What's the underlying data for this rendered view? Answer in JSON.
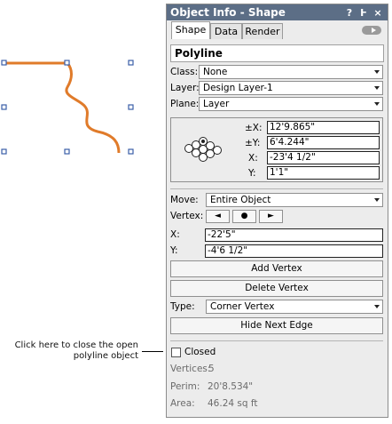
{
  "palette": {
    "title": "Object Info - Shape",
    "help_glyph": "?",
    "pin_glyph": "Ͱ",
    "close_glyph": "×",
    "tabs": [
      {
        "label": "Shape",
        "active": true
      },
      {
        "label": "Data",
        "active": false
      },
      {
        "label": "Render",
        "active": false
      }
    ],
    "object_type": "Polyline",
    "class_label": "Class:",
    "class_value": "None",
    "layer_label": "Layer:",
    "layer_value": "Design Layer-1",
    "plane_label": "Plane:",
    "plane_value": "Layer",
    "coords": {
      "x_label": "±X:",
      "x_value": "12'9.865\"",
      "y_label": "±Y:",
      "y_value": "6'4.244\"",
      "xs_label": "X:",
      "xs_value": "-23'4 1/2\"",
      "ys_label": "Y:",
      "ys_value": "1'1\""
    },
    "move_label": "Move:",
    "move_value": "Entire Object",
    "vertex_label": "Vertex:",
    "vertex_buttons": [
      "◄",
      "●",
      "►"
    ],
    "vx_label": "X:",
    "vx_value": "-22'5\"",
    "vy_label": "Y:",
    "vy_value": "-4'6 1/2\"",
    "add_vertex": "Add Vertex",
    "delete_vertex": "Delete Vertex",
    "type_label": "Type:",
    "type_value": "Corner Vertex",
    "hide_next_edge": "Hide Next Edge",
    "closed_label": "Closed",
    "closed_checked": false,
    "vertices_label": "Vertices:",
    "vertices_value": "5",
    "perim_label": "Perim:",
    "perim_value": "20'8.534\"",
    "area_label": "Area:",
    "area_value": "46.24 sq ft"
  },
  "annotation": {
    "line1": "Click here to close the open",
    "line2": "polyline object"
  },
  "colors": {
    "polyline": "#e07b2a",
    "handle": "#3b5fa8",
    "titlebar": "#5c6e86"
  },
  "icons": {
    "toggle": "toggle-arrow-icon",
    "origin": "origin-point-grid-icon"
  }
}
